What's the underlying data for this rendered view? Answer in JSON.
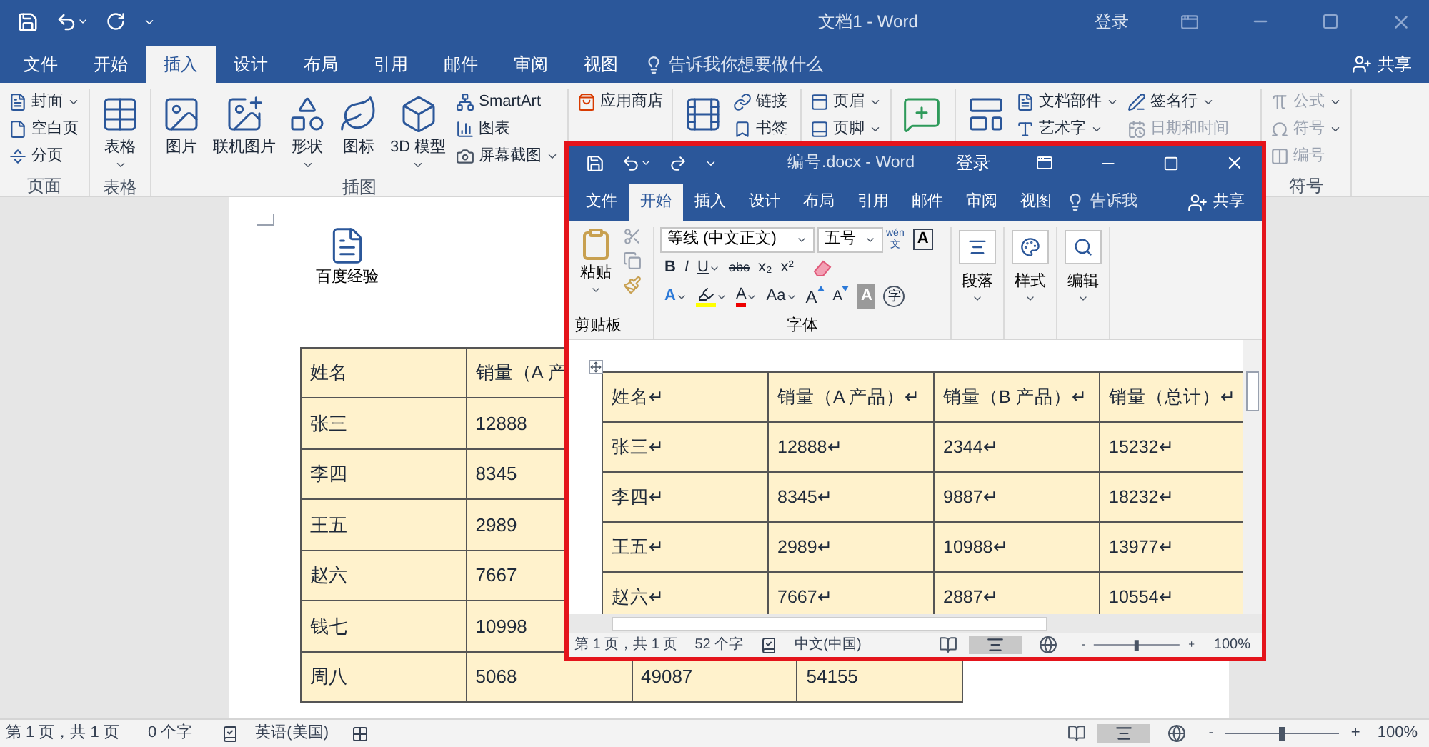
{
  "outer": {
    "title": "文档1 - Word",
    "signin": "登录",
    "tabs": [
      {
        "label": "文件",
        "selected": false
      },
      {
        "label": "开始",
        "selected": false
      },
      {
        "label": "插入",
        "selected": true
      },
      {
        "label": "设计",
        "selected": false
      },
      {
        "label": "布局",
        "selected": false
      },
      {
        "label": "引用",
        "selected": false
      },
      {
        "label": "邮件",
        "selected": false
      },
      {
        "label": "审阅",
        "selected": false
      },
      {
        "label": "视图",
        "selected": false
      }
    ],
    "tell_me": "告诉我你想要做什么",
    "share": "共享",
    "groups": [
      {
        "label": "页面",
        "columns": [
          {
            "kind": "stack",
            "items": [
              {
                "label": "封面",
                "dropdown": true,
                "disabled": false
              },
              {
                "label": "空白页",
                "dropdown": false,
                "disabled": false
              },
              {
                "label": "分页",
                "dropdown": false,
                "disabled": false
              }
            ]
          }
        ]
      },
      {
        "label": "表格",
        "columns": [
          {
            "kind": "large",
            "label": "表格",
            "dropdown": true
          }
        ]
      },
      {
        "label": "插图",
        "columns": [
          {
            "kind": "large",
            "label": "图片",
            "dropdown": false
          },
          {
            "kind": "large",
            "label": "联机图片",
            "dropdown": false
          },
          {
            "kind": "large",
            "label": "形状",
            "dropdown": true
          },
          {
            "kind": "large",
            "label": "图标",
            "dropdown": false
          },
          {
            "kind": "large",
            "label": "3D 模型",
            "dropdown": true
          },
          {
            "kind": "stack",
            "items": [
              {
                "label": "SmartArt",
                "dropdown": false,
                "disabled": false
              },
              {
                "label": "图表",
                "dropdown": false,
                "disabled": false
              },
              {
                "label": "屏幕截图",
                "dropdown": true,
                "disabled": false
              }
            ]
          }
        ]
      },
      {
        "columns": [
          {
            "kind": "stack",
            "items": [
              {
                "label": "应用商店",
                "dropdown": false,
                "disabled": false
              }
            ]
          }
        ]
      },
      {
        "columns": [
          {
            "kind": "large",
            "dropdown": false
          },
          {
            "kind": "stack",
            "items": [
              {
                "label": "链接",
                "dropdown": false,
                "disabled": false
              },
              {
                "label": "书签",
                "dropdown": false,
                "disabled": false
              }
            ]
          }
        ]
      },
      {
        "columns": [
          {
            "kind": "stack",
            "items": [
              {
                "label": "页眉",
                "dropdown": true,
                "disabled": false
              },
              {
                "label": "页脚",
                "dropdown": true,
                "disabled": false
              }
            ]
          }
        ]
      },
      {
        "columns": [
          {
            "kind": "large",
            "dropdown": false
          }
        ]
      },
      {
        "columns": [
          {
            "kind": "large",
            "dropdown": false
          },
          {
            "kind": "stack",
            "items": [
              {
                "label": "文档部件",
                "dropdown": true,
                "disabled": false
              },
              {
                "label": "艺术字",
                "dropdown": true,
                "disabled": false
              }
            ]
          },
          {
            "kind": "stack",
            "items": [
              {
                "label": "签名行",
                "dropdown": true,
                "disabled": false
              },
              {
                "label": "日期和时间",
                "dropdown": false,
                "disabled": true
              }
            ]
          }
        ]
      },
      {
        "label": "符号",
        "columns": [
          {
            "kind": "stack",
            "items": [
              {
                "label": "公式",
                "dropdown": true,
                "disabled": true
              },
              {
                "label": "符号",
                "dropdown": true,
                "disabled": true
              },
              {
                "label": "编号",
                "dropdown": false,
                "disabled": true
              }
            ]
          }
        ]
      }
    ],
    "doc_icon_label": "百度经验",
    "table": {
      "columns": [
        "姓名",
        "销量（A 产"
      ],
      "rows": [
        {
          "cells": [
            "张三",
            "12888"
          ]
        },
        {
          "cells": [
            "李四",
            "8345"
          ]
        },
        {
          "cells": [
            "王五",
            "2989"
          ]
        },
        {
          "cells": [
            "赵六",
            "7667"
          ]
        },
        {
          "cells": [
            "钱七",
            "10998"
          ]
        },
        {
          "cells": [
            "周八",
            "5068",
            "49087",
            "54155"
          ]
        }
      ]
    },
    "status": {
      "page": "第 1 页，共 1 页",
      "words": "0 个字",
      "language": "英语(美国)",
      "zoom_out": "-",
      "zoom_in": "+",
      "zoom": "100%",
      "level": 0.5
    }
  },
  "inner": {
    "title": "编号.docx - Word",
    "signin": "登录",
    "tabs": [
      {
        "label": "文件",
        "selected": false
      },
      {
        "label": "开始",
        "selected": true
      },
      {
        "label": "插入",
        "selected": false
      },
      {
        "label": "设计",
        "selected": false
      },
      {
        "label": "布局",
        "selected": false
      },
      {
        "label": "引用",
        "selected": false
      },
      {
        "label": "邮件",
        "selected": false
      },
      {
        "label": "审阅",
        "selected": false
      },
      {
        "label": "视图",
        "selected": false
      }
    ],
    "tell_me": "告诉我",
    "share": "共享",
    "clipboard": {
      "label": "剪贴板",
      "paste": "粘贴"
    },
    "font": {
      "label": "字体",
      "font_name": "等线 (中文正文)",
      "font_size": "五号",
      "phonetic_top": "wén",
      "phonetic_bottom": "文",
      "border_char": "A",
      "format_buttons": [
        {
          "text": "B",
          "kind": "bold",
          "dropdown": false
        },
        {
          "text": "I",
          "kind": "italic",
          "dropdown": false
        },
        {
          "text": "U",
          "kind": "underline",
          "dropdown": true
        },
        {
          "text": "abc",
          "kind": "strike",
          "dropdown": false
        },
        {
          "text": "x₂",
          "kind": "plain",
          "dropdown": false
        },
        {
          "text": "x²",
          "kind": "plain",
          "dropdown": false
        },
        {
          "kind": "clear",
          "dropdown": false
        }
      ],
      "effect_buttons": [
        {
          "text": "A",
          "kind": "effect",
          "dropdown": true
        },
        {
          "kind": "highlight",
          "dropdown": true
        },
        {
          "text": "A",
          "kind": "color",
          "dropdown": true
        },
        {
          "text": "Aa",
          "kind": "plain",
          "dropdown": true
        },
        {
          "text": "A",
          "kind": "grow",
          "dropdown": false
        },
        {
          "text": "A",
          "kind": "shrink",
          "dropdown": false
        },
        {
          "text": "A",
          "kind": "shade",
          "dropdown": false
        },
        {
          "text": "字",
          "kind": "enclose",
          "dropdown": false
        }
      ]
    },
    "big_groups": [
      {
        "label": "段落"
      },
      {
        "label": "样式"
      },
      {
        "label": "编辑"
      }
    ],
    "table": {
      "columns": [
        "姓名↵",
        "销量（A 产品）↵",
        "销量（B 产品）↵",
        "销量（总计）↵"
      ],
      "rows": [
        {
          "cells": [
            "张三↵",
            "12888↵",
            "2344↵",
            "15232↵"
          ]
        },
        {
          "cells": [
            "李四↵",
            "8345↵",
            "9887↵",
            "18232↵"
          ]
        },
        {
          "cells": [
            "王五↵",
            "2989↵",
            "10988↵",
            "13977↵"
          ]
        },
        {
          "cells": [
            "赵六↵",
            "7667↵",
            "2887↵",
            "10554↵"
          ]
        }
      ]
    },
    "status": {
      "page": "第 1 页，共 1 页",
      "words": "52 个字",
      "language": "中文(中国)",
      "zoom_out": "-",
      "zoom_in": "+",
      "zoom": "100%",
      "level": 0.5
    }
  }
}
